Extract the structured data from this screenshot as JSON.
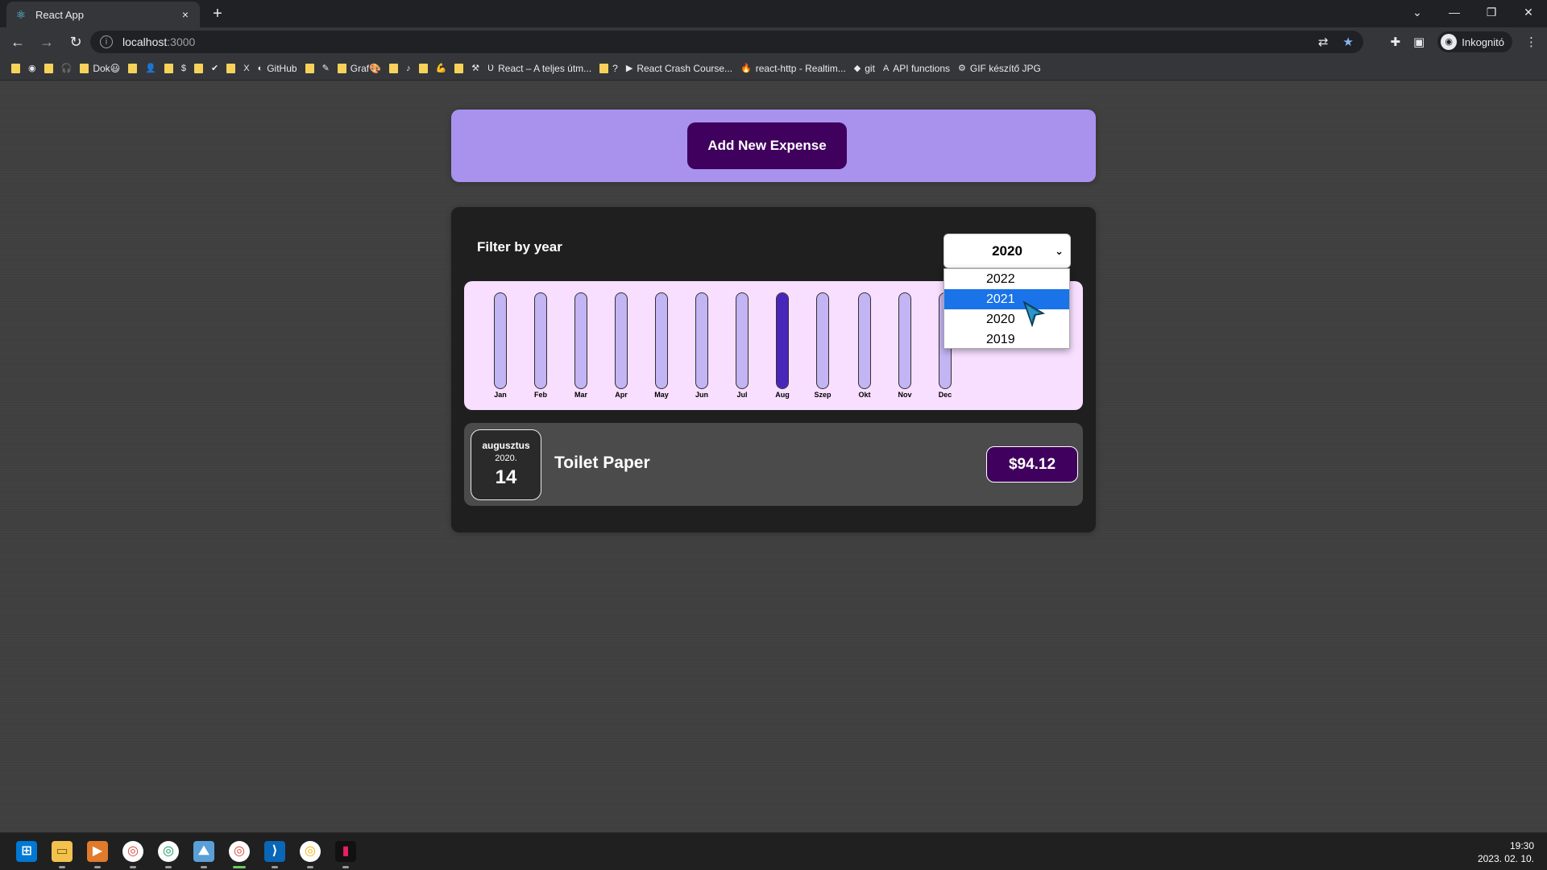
{
  "browser": {
    "tab_title": "React App",
    "tab_icon": "react-icon",
    "tab_close": "×",
    "new_tab": "+",
    "url_host": "localhost",
    "url_port": ":3000",
    "profile_label": "Inkognitó",
    "window_controls": [
      "⌄",
      "—",
      "❐",
      "✕"
    ],
    "bookmarks": [
      {
        "label": "",
        "icon": "folder"
      },
      {
        "label": "",
        "icon": "globe"
      },
      {
        "label": "",
        "icon": "folder"
      },
      {
        "label": "",
        "icon": "headphones"
      },
      {
        "label": "Dok😃",
        "icon": "folder"
      },
      {
        "label": "",
        "icon": "folder"
      },
      {
        "label": "",
        "icon": "person"
      },
      {
        "label": "",
        "icon": "folder"
      },
      {
        "label": "",
        "icon": "dollar"
      },
      {
        "label": "",
        "icon": "folder"
      },
      {
        "label": "",
        "icon": "check"
      },
      {
        "label": "",
        "icon": "folder"
      },
      {
        "label": "",
        "icon": "excel"
      },
      {
        "label": "GitHub",
        "icon": "github"
      },
      {
        "label": "",
        "icon": "folder"
      },
      {
        "label": "",
        "icon": "pencil"
      },
      {
        "label": "Graf🎨",
        "icon": "folder"
      },
      {
        "label": "",
        "icon": "folder"
      },
      {
        "label": "",
        "icon": "guitar"
      },
      {
        "label": "",
        "icon": "folder"
      },
      {
        "label": "",
        "icon": "muscle"
      },
      {
        "label": "",
        "icon": "folder"
      },
      {
        "label": "",
        "icon": "tools"
      },
      {
        "label": "React – A teljes útm...",
        "icon": "udemy"
      },
      {
        "label": "?",
        "icon": "folder"
      },
      {
        "label": "React Crash Course...",
        "icon": "youtube"
      },
      {
        "label": "react-http - Realtim...",
        "icon": "firebase"
      },
      {
        "label": "git",
        "icon": "git"
      },
      {
        "label": "API functions",
        "icon": "api"
      },
      {
        "label": "GIF készítő JPG",
        "icon": "gif"
      }
    ]
  },
  "app": {
    "add_button_label": "Add New Expense",
    "filter_label": "Filter by year",
    "selected_year": "2020",
    "year_options": [
      "2022",
      "2021",
      "2020",
      "2019"
    ],
    "highlighted_option": "2021"
  },
  "chart_data": {
    "type": "bar",
    "categories": [
      "Jan",
      "Feb",
      "Mar",
      "Apr",
      "May",
      "Jun",
      "Jul",
      "Aug",
      "Szep",
      "Okt",
      "Nov",
      "Dec"
    ],
    "values": [
      0,
      0,
      0,
      0,
      0,
      0,
      0,
      94.12,
      0,
      0,
      0,
      0
    ],
    "max": 94.12,
    "colors": {
      "fill": "#4826b9",
      "track": "#c3b4f3",
      "background": "#f8dfff"
    }
  },
  "expense": {
    "month": "augusztus",
    "year": "2020.",
    "day": "14",
    "title": "Toilet Paper",
    "amount": "$94.12"
  },
  "taskbar": {
    "apps": [
      "windows-start-icon",
      "file-explorer-icon",
      "media-icon",
      "chrome-icon",
      "chrome-profile-icon",
      "photos-icon",
      "chrome-active-icon",
      "vscode-icon",
      "chrome-profile2-icon",
      "terminal-icon"
    ],
    "time": "19:30",
    "date": "2023. 02. 10."
  },
  "colors": {
    "accent_purple": "#40005d",
    "panel_lavender": "#a892ee",
    "selection_blue": "#1a73e8"
  }
}
